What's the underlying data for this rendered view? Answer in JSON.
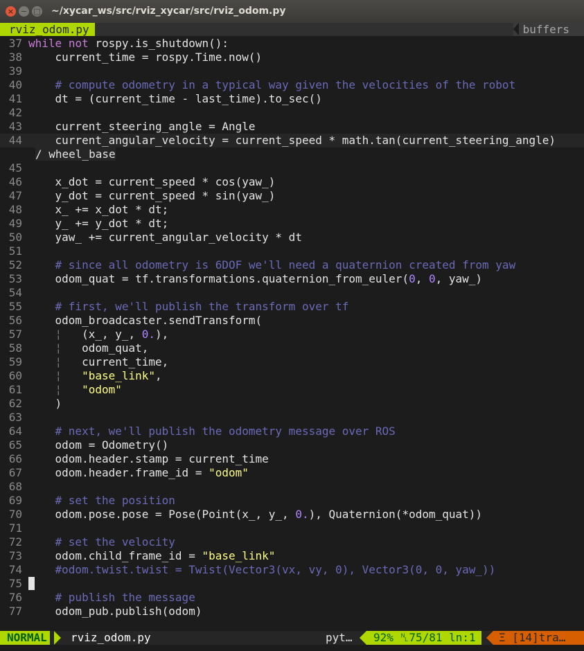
{
  "window": {
    "title": "~/xycar_ws/src/rviz_xycar/src/rviz_odom.py",
    "close_glyph": "×",
    "min_glyph": "−",
    "max_glyph": "□"
  },
  "tabline": {
    "active_tab": "rviz_odom.py",
    "right_label": "buffers"
  },
  "code": {
    "l37": {
      "n": "37",
      "a": "while",
      "b": " ",
      "c": "not",
      "d": " rospy.is_shutdown():"
    },
    "l38": {
      "n": "38",
      "t": "    current_time = rospy.Time.now()"
    },
    "l39": {
      "n": "39"
    },
    "l40": {
      "n": "40",
      "t": "    ",
      "c": "# compute odometry in a typical way given the velocities of the robot"
    },
    "l41": {
      "n": "41",
      "t": "    dt = (current_time - last_time).to_sec()"
    },
    "l42": {
      "n": "42"
    },
    "l43": {
      "n": "43",
      "t": "    current_steering_angle = Angle"
    },
    "l44": {
      "n": "44",
      "t": "    current_angular_velocity = current_speed * math.tan(current_steering_angle)",
      "w": "/ wheel_base"
    },
    "l45": {
      "n": "45"
    },
    "l46": {
      "n": "46",
      "t": "    x_dot = current_speed * cos(yaw_)"
    },
    "l47": {
      "n": "47",
      "t": "    y_dot = current_speed * sin(yaw_)"
    },
    "l48": {
      "n": "48",
      "t": "    x_ += x_dot * dt;"
    },
    "l49": {
      "n": "49",
      "t": "    y_ += y_dot * dt;"
    },
    "l50": {
      "n": "50",
      "t": "    yaw_ += current_angular_velocity * dt"
    },
    "l51": {
      "n": "51"
    },
    "l52": {
      "n": "52",
      "t": "    ",
      "c": "# since all odometry is 6DOF we'll need a quaternion created from yaw"
    },
    "l53": {
      "n": "53",
      "a": "    odom_quat = tf.transformations.quaternion_from_euler(",
      "b": "0",
      ",": ", ",
      "c": "0",
      "d": ", yaw_)"
    },
    "l54": {
      "n": "54"
    },
    "l55": {
      "n": "55",
      "t": "    ",
      "c": "# first, we'll publish the transform over tf"
    },
    "l56": {
      "n": "56",
      "t": "    odom_broadcaster.sendTransform("
    },
    "l57": {
      "n": "57",
      "g": "    ¦   ",
      "a": "(x_, y_, ",
      "b": "0.",
      "d": "),"
    },
    "l58": {
      "n": "58",
      "g": "    ¦   ",
      "t": "odom_quat,"
    },
    "l59": {
      "n": "59",
      "g": "    ¦   ",
      "t": "current_time,"
    },
    "l60": {
      "n": "60",
      "g": "    ¦   ",
      "s": "\"base_link\"",
      "t": ","
    },
    "l61": {
      "n": "61",
      "g": "    ¦   ",
      "s": "\"odom\""
    },
    "l62": {
      "n": "62",
      "t": "    )"
    },
    "l63": {
      "n": "63"
    },
    "l64": {
      "n": "64",
      "t": "    ",
      "c": "# next, we'll publish the odometry message over ROS"
    },
    "l65": {
      "n": "65",
      "t": "    odom = Odometry()"
    },
    "l66": {
      "n": "66",
      "t": "    odom.header.stamp = current_time"
    },
    "l67": {
      "n": "67",
      "t": "    odom.header.frame_id = ",
      "s": "\"odom\""
    },
    "l68": {
      "n": "68"
    },
    "l69": {
      "n": "69",
      "t": "    ",
      "c": "# set the position"
    },
    "l70": {
      "n": "70",
      "a": "    odom.pose.pose = Pose(Point(x_, y_, ",
      "b": "0.",
      "d": "), Quaternion(*odom_quat))"
    },
    "l71": {
      "n": "71"
    },
    "l72": {
      "n": "72",
      "t": "    ",
      "c": "# set the velocity"
    },
    "l73": {
      "n": "73",
      "t": "    odom.child_frame_id = ",
      "s": "\"base_link\""
    },
    "l74": {
      "n": "74",
      "t": "    ",
      "c": "#odom.twist.twist = Twist(Vector3(vx, vy, 0), Vector3(0, 0, yaw_))"
    },
    "l75": {
      "n": "75"
    },
    "l76": {
      "n": "76",
      "t": "    ",
      "c": "# publish the message"
    },
    "l77": {
      "n": "77",
      "t": "    odom_pub.publish(odom)"
    }
  },
  "statusline": {
    "mode": "NORMAL",
    "filename": "rviz_odom.py",
    "filetype": "pyt…",
    "position": "92% ␤75/81 ln:1",
    "warnings": "Ξ [14]tra…"
  },
  "colors": {
    "accent": "#afd700",
    "comment": "#6a6ab8",
    "keyword": "#c77cd8",
    "string": "#ffff87",
    "number": "#af87ff",
    "warning": "#d75f00"
  }
}
